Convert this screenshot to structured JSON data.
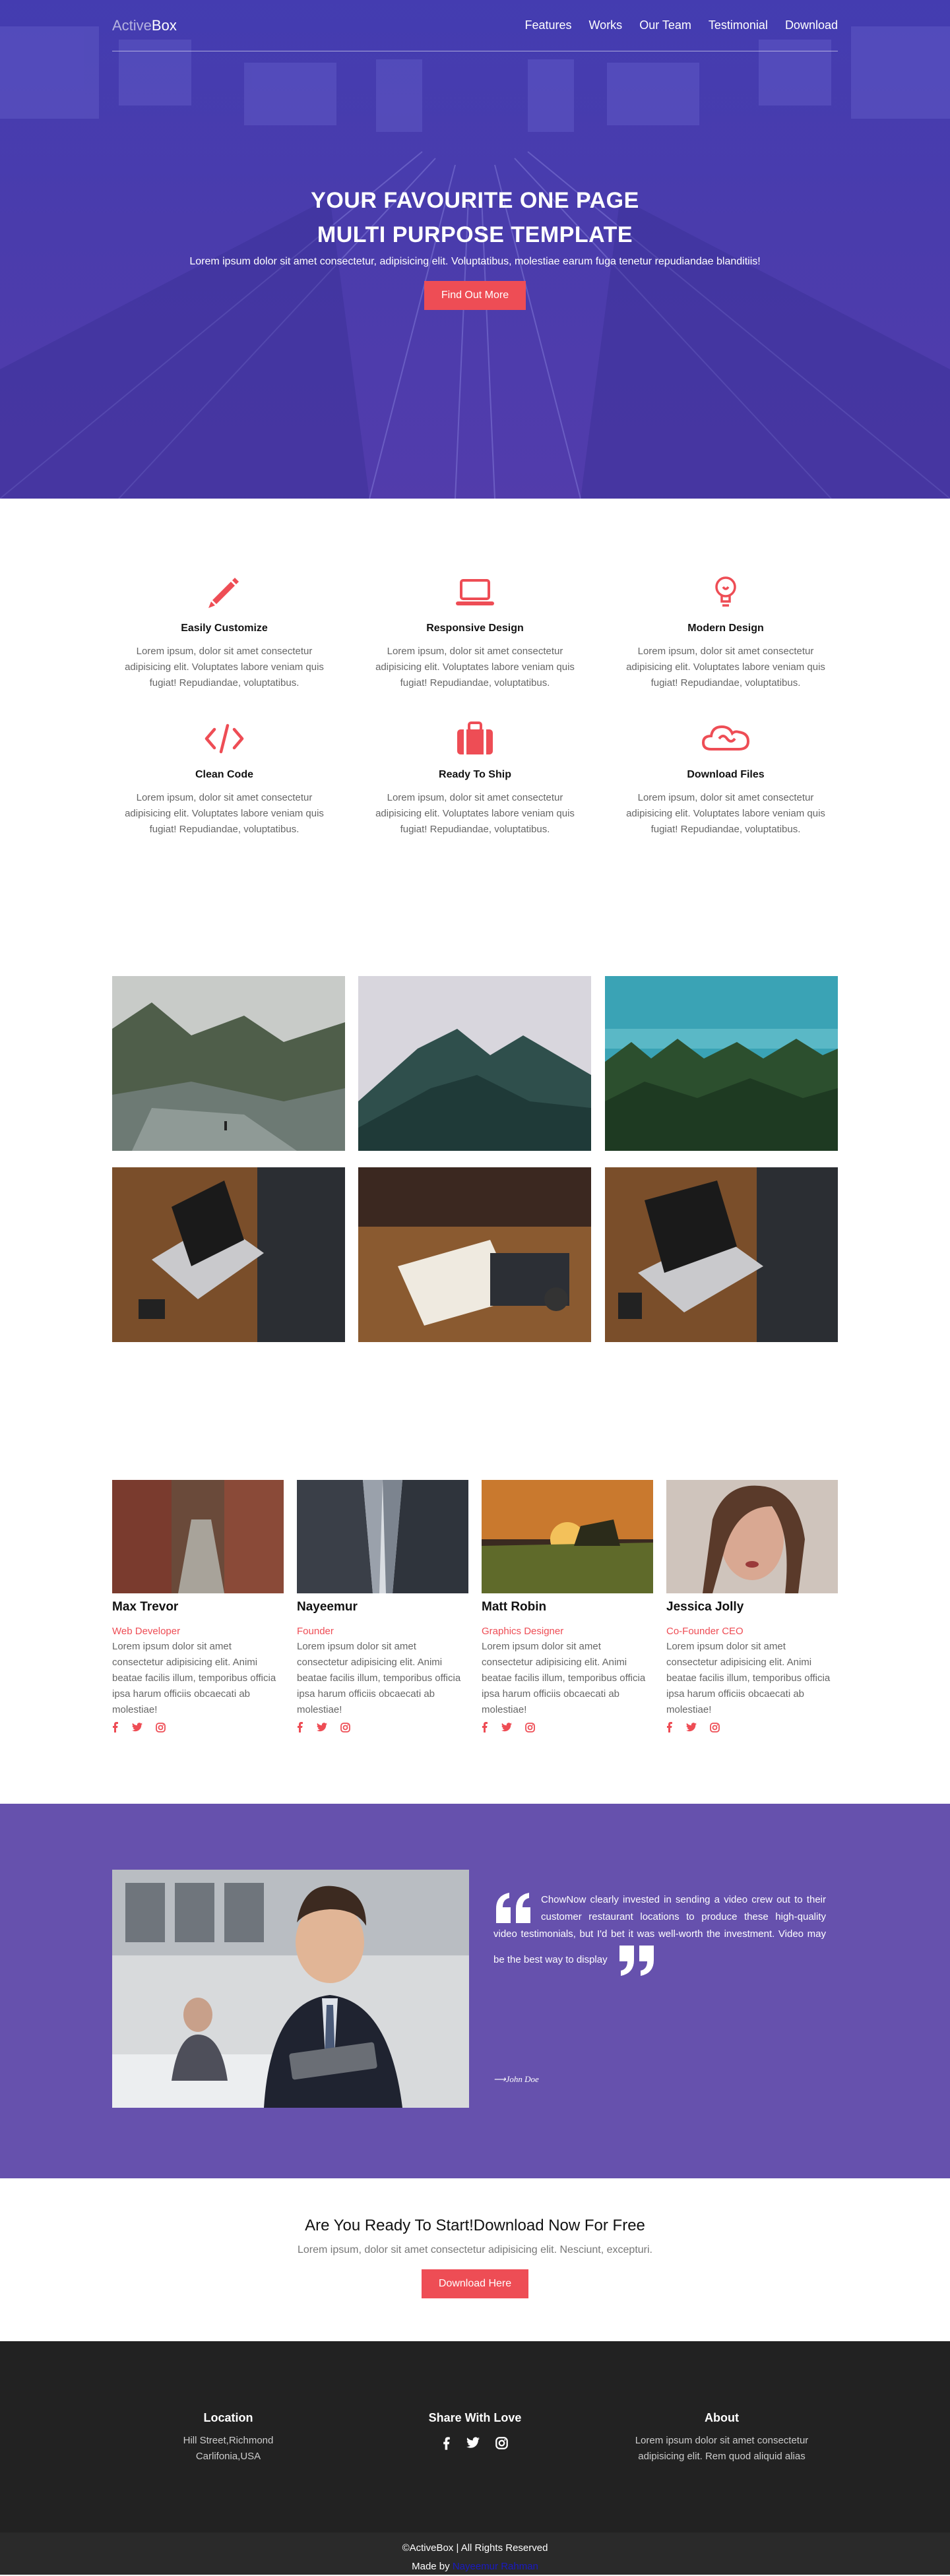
{
  "nav": {
    "brand_light": "Active",
    "brand_bold": "Box",
    "items": [
      "Features",
      "Works",
      "Our Team",
      "Testimonial",
      "Download"
    ]
  },
  "hero": {
    "title_line1": "YOUR FAVOURITE ONE PAGE",
    "title_line2": "MULTI PURPOSE TEMPLATE",
    "subtitle": "Lorem ipsum dolor sit amet consectetur, adipisicing elit. Voluptatibus, molestiae earum fuga tenetur repudiandae blanditiis!",
    "button": "Find Out More"
  },
  "features": [
    {
      "icon": "pencil-icon",
      "title": "Easily Customize",
      "text": "Lorem ipsum, dolor sit amet consectetur adipisicing elit. Voluptates labore veniam quis fugiat! Repudiandae, voluptatibus."
    },
    {
      "icon": "laptop-icon",
      "title": "Responsive Design",
      "text": "Lorem ipsum, dolor sit amet consectetur adipisicing elit. Voluptates labore veniam quis fugiat! Repudiandae, voluptatibus."
    },
    {
      "icon": "lightbulb-icon",
      "title": "Modern Design",
      "text": "Lorem ipsum, dolor sit amet consectetur adipisicing elit. Voluptates labore veniam quis fugiat! Repudiandae, voluptatibus."
    },
    {
      "icon": "code-icon",
      "title": "Clean Code",
      "text": "Lorem ipsum, dolor sit amet consectetur adipisicing elit. Voluptates labore veniam quis fugiat! Repudiandae, voluptatibus."
    },
    {
      "icon": "suitcase-icon",
      "title": "Ready To Ship",
      "text": "Lorem ipsum, dolor sit amet consectetur adipisicing elit. Voluptates labore veniam quis fugiat! Repudiandae, voluptatibus."
    },
    {
      "icon": "cloud-icon",
      "title": "Download Files",
      "text": "Lorem ipsum, dolor sit amet consectetur adipisicing elit. Voluptates labore veniam quis fugiat! Repudiandae, voluptatibus."
    }
  ],
  "team": [
    {
      "name": "Max Trevor",
      "role": "Web Developer",
      "bio": "Lorem ipsum dolor sit amet consectetur adipisicing elit. Animi beatae facilis illum, temporibus officia ipsa harum officiis obcaecati ab molestiae!"
    },
    {
      "name": "Nayeemur",
      "role": "Founder",
      "bio": "Lorem ipsum dolor sit amet consectetur adipisicing elit. Animi beatae facilis illum, temporibus officia ipsa harum officiis obcaecati ab molestiae!"
    },
    {
      "name": "Matt Robin",
      "role": "Graphics Designer",
      "bio": "Lorem ipsum dolor sit amet consectetur adipisicing elit. Animi beatae facilis illum, temporibus officia ipsa harum officiis obcaecati ab molestiae!"
    },
    {
      "name": "Jessica Jolly",
      "role": "Co-Founder CEO",
      "bio": "Lorem ipsum dolor sit amet consectetur adipisicing elit. Animi beatae facilis illum, temporibus officia ipsa harum officiis obcaecati ab molestiae!"
    }
  ],
  "testimonial": {
    "quote": "ChowNow clearly invested in sending a video crew out to their customer restaurant locations to produce these high-quality video testimonials, but I'd bet it was well-worth the investment. Video may be the best way to display",
    "author": "⟶John Doe"
  },
  "cta": {
    "title": "Are You Ready To Start!Download Now For Free",
    "text": "Lorem ipsum, dolor sit amet consectetur adipisicing elit. Nesciunt, excepturi.",
    "button": "Download Here"
  },
  "footer": {
    "location_title": "Location",
    "location_line1": "Hill Street,Richmond",
    "location_line2": "Carlifonia,USA",
    "share_title": "Share With Love",
    "about_title": "About",
    "about_text": "Lorem ipsum dolor sit amet consectetur adipisicing elit. Rem quod aliquid alias",
    "copyright": "©ActiveBox | All Rights Reserved",
    "made_by_label": "Made by",
    "made_by_link": "Nayeemur Rahman"
  },
  "colors": {
    "accent": "#ee4d55",
    "hero": "#4a3ead",
    "testimonial_bg": "#6651ad",
    "footer_bg": "#222222"
  }
}
